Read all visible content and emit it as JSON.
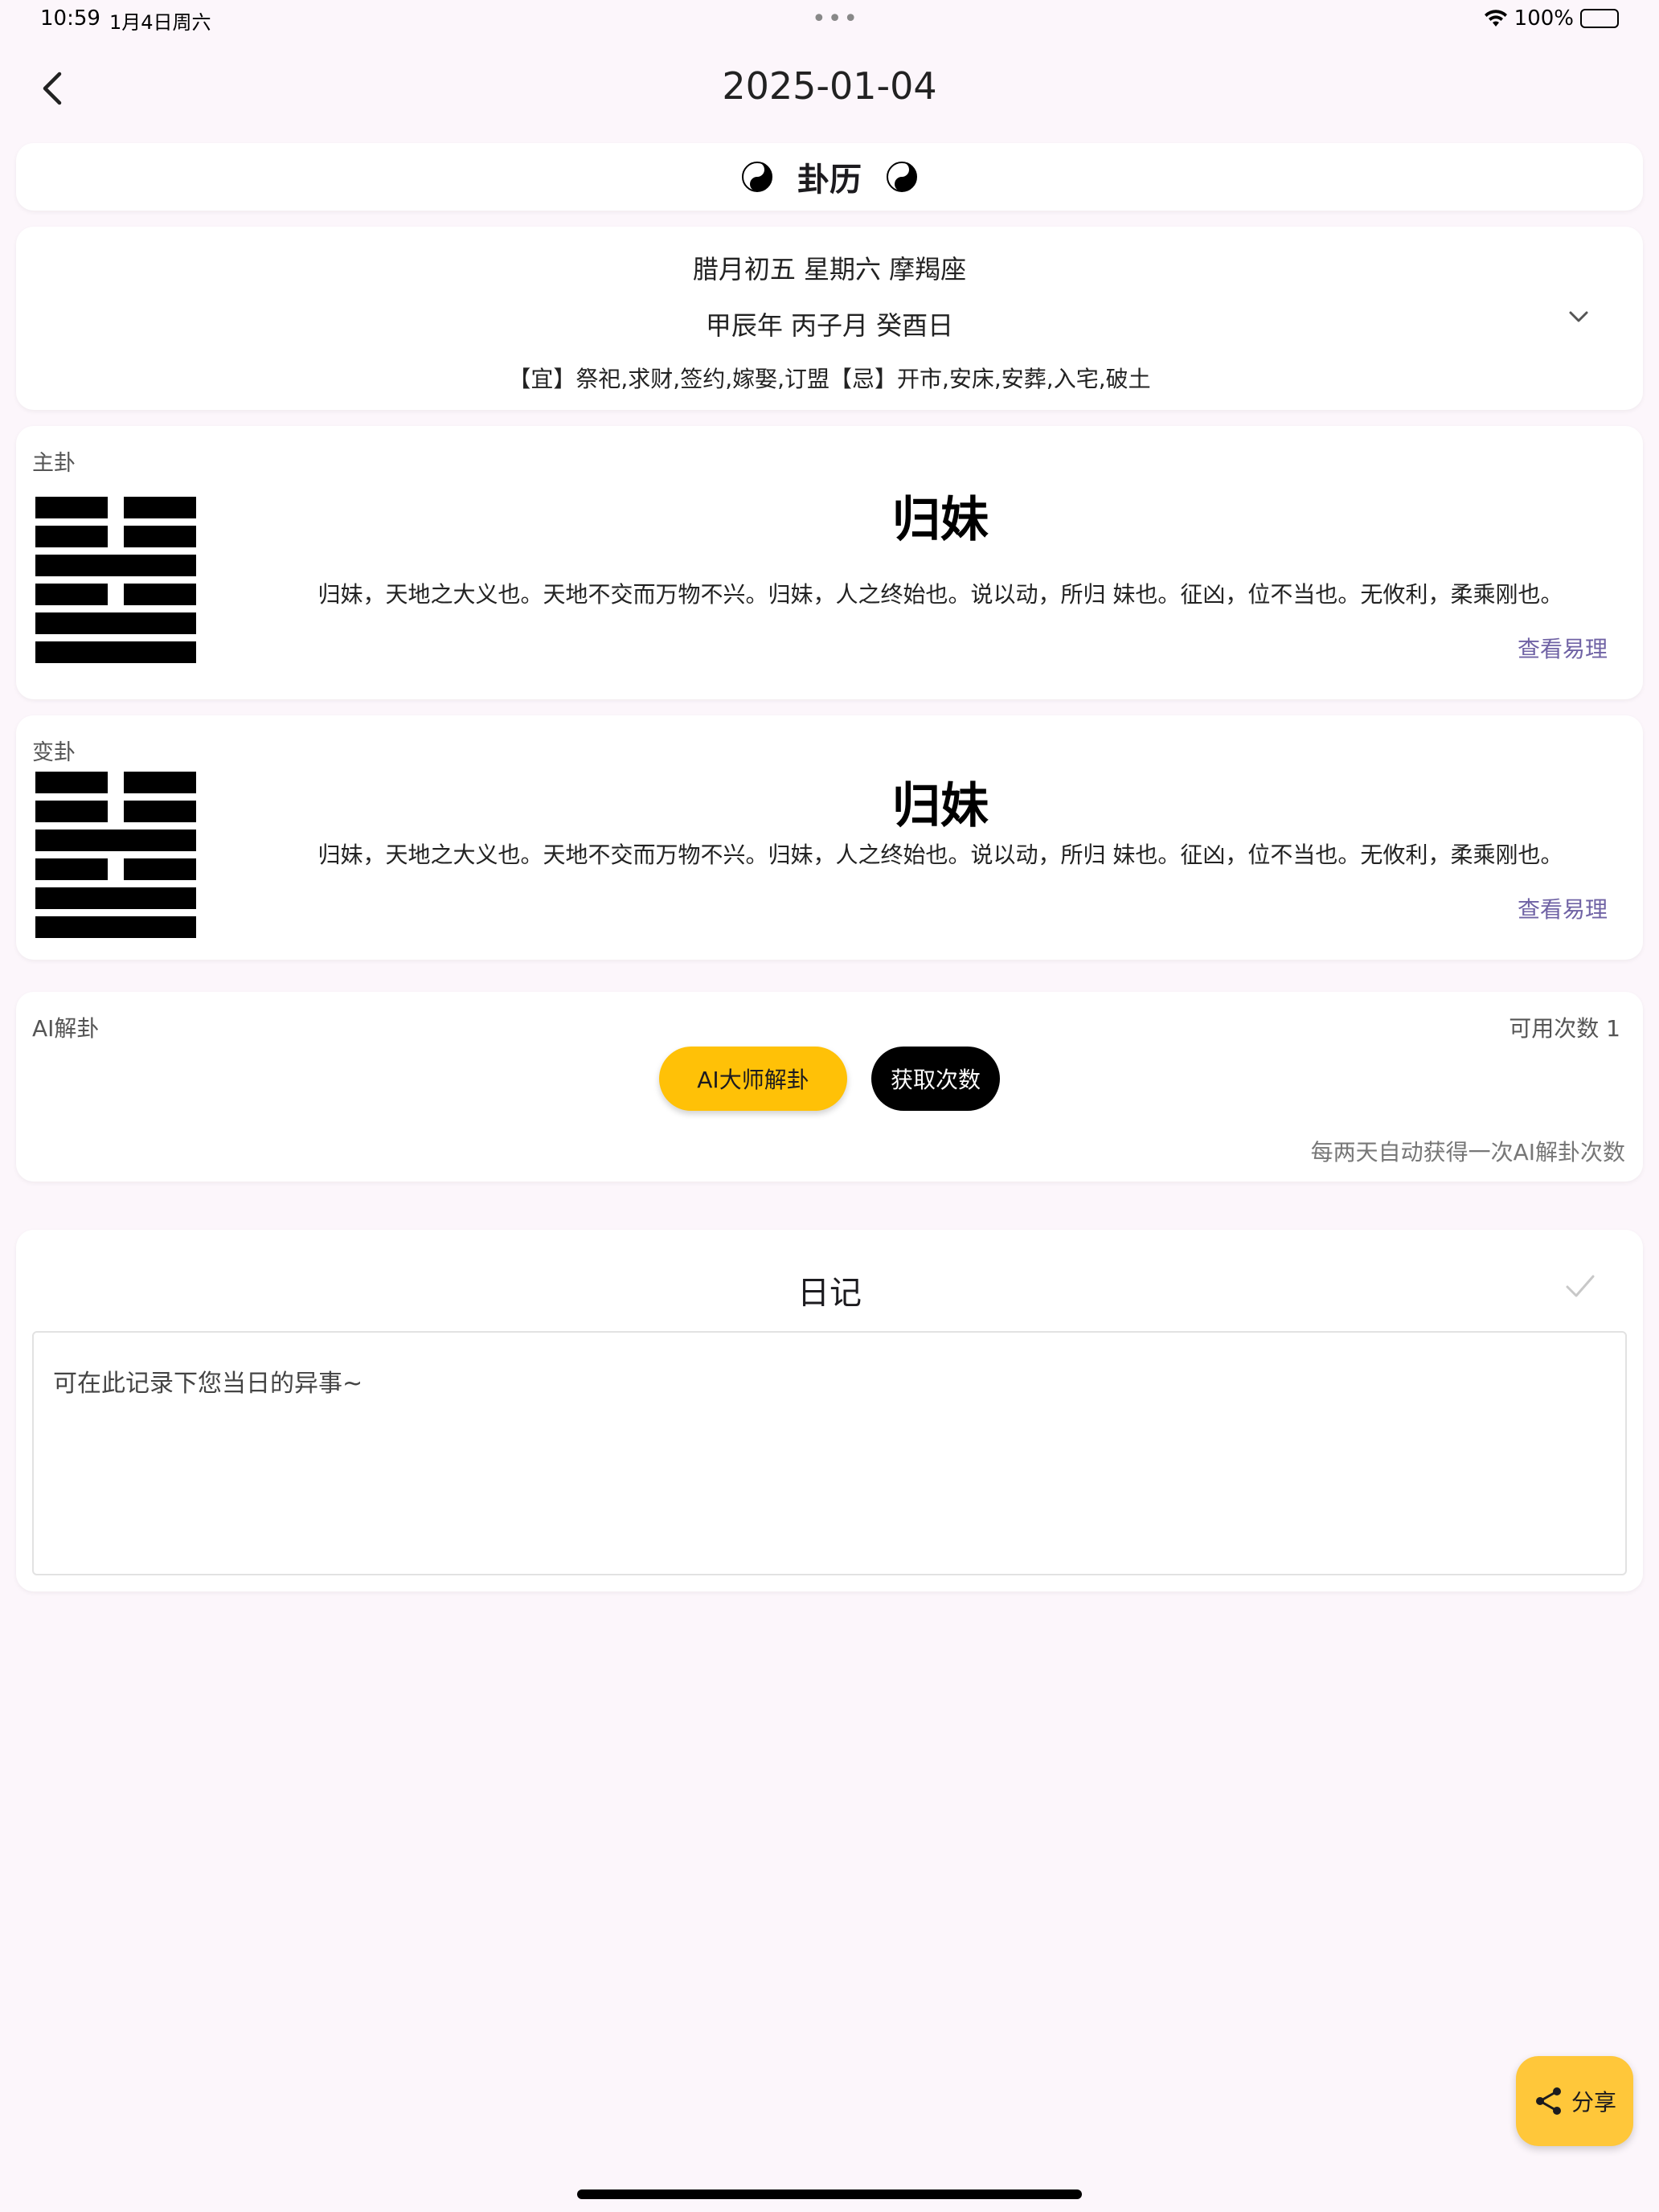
{
  "status_bar": {
    "time": "10:59",
    "date": "1月4日周六",
    "dots": "•••",
    "battery_percent": "100%"
  },
  "app_bar": {
    "title": "2025-01-04"
  },
  "header": {
    "title": "卦历"
  },
  "lunar": {
    "line1": "腊月初五   星期六   摩羯座",
    "line2": "甲辰年   丙子月   癸酉日",
    "line3": "【宜】祭祀,求财,签约,嫁娶,订盟【忌】开市,安床,安葬,入宅,破土"
  },
  "main_hexagram": {
    "label": "主卦",
    "name": "归妹",
    "description": "归妹，天地之大义也。天地不交而万物不兴。归妹，人之终始也。说以动，所归 妹也。征凶，位不当也。无攸利，柔乘刚也。",
    "link": "查看易理"
  },
  "changed_hexagram": {
    "label": "变卦",
    "name": "归妹",
    "description": "归妹，天地之大义也。天地不交而万物不兴。归妹，人之终始也。说以动，所归 妹也。征凶，位不当也。无攸利，柔乘刚也。",
    "link": "查看易理"
  },
  "ai": {
    "label": "AI解卦",
    "count": "可用次数 1",
    "master_button": "AI大师解卦",
    "get_count_button": "获取次数",
    "note": "每两天自动获得一次AI解卦次数"
  },
  "diary": {
    "title": "日记",
    "placeholder": "可在此记录下您当日的异事~"
  },
  "share": {
    "label": "分享"
  },
  "colors": {
    "background": "#fcf6fb",
    "accent": "#ffc107",
    "link": "#7063a5"
  }
}
